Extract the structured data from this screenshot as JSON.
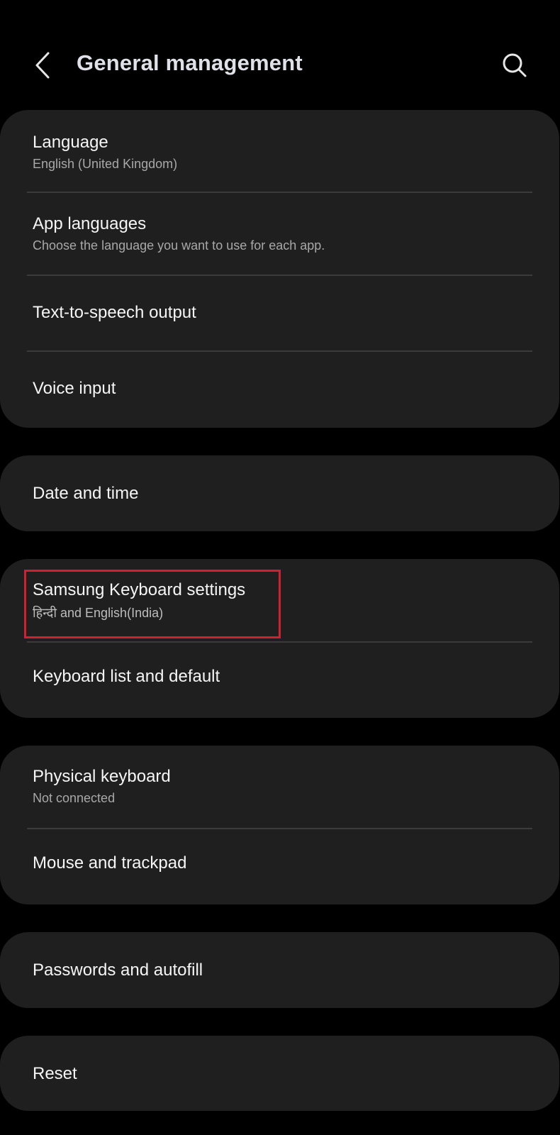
{
  "header": {
    "title": "General management",
    "back_icon": "chevron-left-icon",
    "search_icon": "search-icon"
  },
  "groups": [
    {
      "items": [
        {
          "title": "Language",
          "subtitle": "English (United Kingdom)"
        },
        {
          "title": "App languages",
          "subtitle": "Choose the language you want to use for each app."
        },
        {
          "title": "Text-to-speech output"
        },
        {
          "title": "Voice input"
        }
      ]
    },
    {
      "items": [
        {
          "title": "Date and time"
        }
      ]
    },
    {
      "items": [
        {
          "title": "Samsung Keyboard settings",
          "subtitle": "हिन्दी and English(India)",
          "highlighted": true
        },
        {
          "title": "Keyboard list and default"
        }
      ]
    },
    {
      "items": [
        {
          "title": "Physical keyboard",
          "subtitle": "Not connected"
        },
        {
          "title": "Mouse and trackpad"
        }
      ]
    },
    {
      "items": [
        {
          "title": "Passwords and autofill"
        }
      ]
    },
    {
      "items": [
        {
          "title": "Reset"
        }
      ]
    }
  ],
  "colors": {
    "background": "#000000",
    "card": "#1f1f1f",
    "divider": "#3b3b3b",
    "highlight": "#d3202e"
  }
}
